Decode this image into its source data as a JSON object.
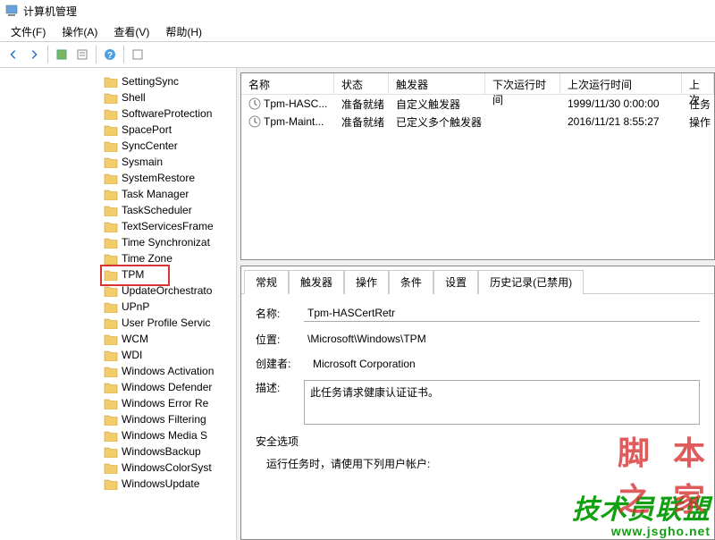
{
  "title": "计算机管理",
  "menu": {
    "file": "文件(F)",
    "action": "操作(A)",
    "view": "查看(V)",
    "help": "帮助(H)"
  },
  "tree": {
    "items": [
      "SettingSync",
      "Shell",
      "SoftwareProtection",
      "SpacePort",
      "SyncCenter",
      "Sysmain",
      "SystemRestore",
      "Task Manager",
      "TaskScheduler",
      "TextServicesFrame",
      "Time Synchronizat",
      "Time Zone",
      "TPM",
      "UpdateOrchestrato",
      "UPnP",
      "User Profile Servic",
      "WCM",
      "WDI",
      "Windows Activation",
      "Windows Defender",
      "Windows Error Re",
      "Windows Filtering",
      "Windows Media S",
      "WindowsBackup",
      "WindowsColorSyst",
      "WindowsUpdate"
    ],
    "highlighted_index": 12
  },
  "task_list": {
    "columns": {
      "name": "名称",
      "status": "状态",
      "trigger": "触发器",
      "next_run": "下次运行时间",
      "last_run": "上次运行时间",
      "result": "上次"
    },
    "rows": [
      {
        "name": "Tpm-HASC...",
        "status": "准备就绪",
        "trigger": "自定义触发器",
        "next_run": "",
        "last_run": "1999/11/30 0:00:00",
        "result": "任务"
      },
      {
        "name": "Tpm-Maint...",
        "status": "准备就绪",
        "trigger": "已定义多个触发器",
        "next_run": "",
        "last_run": "2016/11/21 8:55:27",
        "result": "操作"
      }
    ]
  },
  "detail": {
    "tabs": {
      "general": "常规",
      "triggers": "触发器",
      "actions": "操作",
      "conditions": "条件",
      "settings": "设置",
      "history": "历史记录(已禁用)"
    },
    "labels": {
      "name": "名称:",
      "location": "位置:",
      "author": "创建者:",
      "description": "描述:",
      "security": "安全选项",
      "run_as": "运行任务时，请使用下列用户帐户:"
    },
    "values": {
      "name": "Tpm-HASCertRetr",
      "location": "\\Microsoft\\Windows\\TPM",
      "author": "Microsoft Corporation",
      "description": "此任务请求健康认证证书。"
    }
  },
  "watermark": {
    "line1": "技术员联盟",
    "line2": "www.jsgho.net",
    "line3": "脚 本 之 家"
  }
}
